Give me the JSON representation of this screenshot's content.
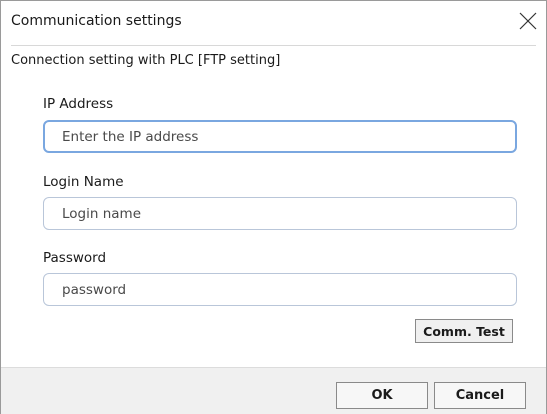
{
  "dialog": {
    "title": "Communication settings",
    "subtitle": "Connection setting with PLC [FTP setting]"
  },
  "fields": {
    "ip_address": {
      "label": "IP Address",
      "placeholder": "Enter the IP address",
      "value": ""
    },
    "login_name": {
      "label": "Login Name",
      "placeholder": "Login name",
      "value": ""
    },
    "password": {
      "label": "Password",
      "placeholder": "password",
      "value": ""
    }
  },
  "buttons": {
    "comm_test": "Comm. Test",
    "ok": "OK",
    "cancel": "Cancel"
  },
  "icons": {
    "close": "close-icon"
  },
  "colors": {
    "focus_border": "#7aa7e0",
    "field_border": "#b9c6d9",
    "footer_bg": "#f0f0f0"
  }
}
